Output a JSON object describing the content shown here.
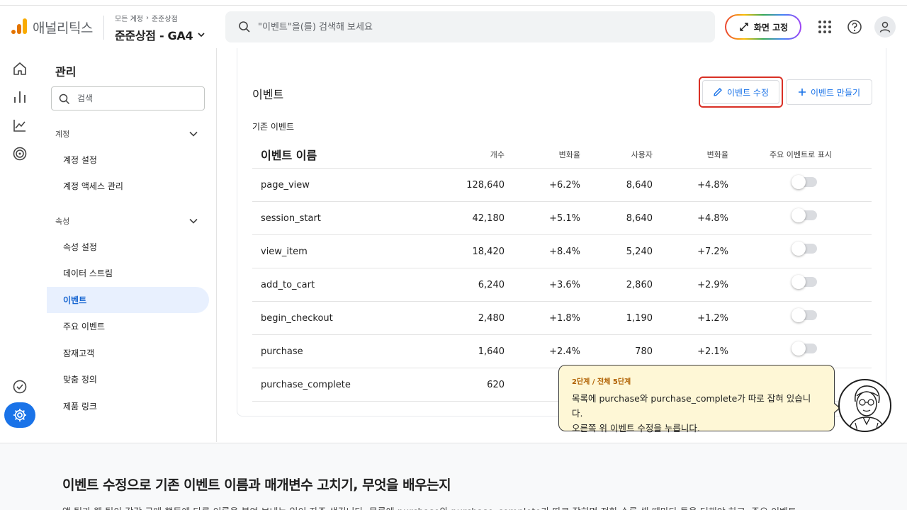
{
  "header": {
    "app_name": "애널리틱스",
    "breadcrumb_all": "모든 계정",
    "breadcrumb_account": "준준상점",
    "property": "준준상점 - GA4",
    "search_placeholder": "\"이벤트\"을(를) 검색해 보세요",
    "pin_label": "화면 고정"
  },
  "admin": {
    "title": "관리",
    "search_placeholder": "검색",
    "account_section": "계정",
    "account_items": [
      "계정 설정",
      "계정 액세스 관리"
    ],
    "property_section": "속성",
    "property_items": [
      "속성 설정",
      "데이터 스트림",
      "이벤트",
      "주요 이벤트",
      "잠재고객",
      "맞춤 정의",
      "제품 링크"
    ],
    "active_item": "이벤트"
  },
  "events": {
    "title": "이벤트",
    "edit_button": "이벤트 수정",
    "create_button": "이벤트 만들기",
    "subtitle": "기존 이벤트",
    "columns": [
      "이벤트 이름",
      "개수",
      "변화율",
      "사용자",
      "변화율",
      "주요 이벤트로 표시"
    ],
    "rows": [
      {
        "name": "page_view",
        "count": "128,640",
        "count_change": "+6.2%",
        "users": "8,640",
        "users_change": "+4.8%",
        "key": false
      },
      {
        "name": "session_start",
        "count": "42,180",
        "count_change": "+5.1%",
        "users": "8,640",
        "users_change": "+4.8%",
        "key": false
      },
      {
        "name": "view_item",
        "count": "18,420",
        "count_change": "+8.4%",
        "users": "5,240",
        "users_change": "+7.2%",
        "key": false
      },
      {
        "name": "add_to_cart",
        "count": "6,240",
        "count_change": "+3.6%",
        "users": "2,860",
        "users_change": "+2.9%",
        "key": false
      },
      {
        "name": "begin_checkout",
        "count": "2,480",
        "count_change": "+1.8%",
        "users": "1,190",
        "users_change": "+1.2%",
        "key": false
      },
      {
        "name": "purchase",
        "count": "1,640",
        "count_change": "+2.4%",
        "users": "780",
        "users_change": "+2.1%",
        "key": false
      },
      {
        "name": "purchase_complete",
        "count": "620",
        "count_change": "+",
        "users": "",
        "users_change": "",
        "key": false
      }
    ]
  },
  "tooltip": {
    "step": "2단계 / 전체 5단계",
    "line1": "목록에 purchase와 purchase_complete가 따로 잡혀 있습니다.",
    "line2": "오른쪽 위 이벤트 수정을 누릅니다."
  },
  "lesson": {
    "title": "이벤트 수정으로 기존 이벤트 이름과 매개변수 고치기, 무엇을 배우는지",
    "body": "앱 팀과 웹 팀이 각각 구매 행동에 다른 이름을 붙여 보내는 일이 자주 생깁니다. 목록에 purchase와 purchase_complete가 따로 잡히면 전환 수를 셀 때마다 둘을 더해야 하고, 주요 이벤트"
  },
  "colors": {
    "brand_orange": "#e37400",
    "brand_yellow": "#f9ab00",
    "primary_blue": "#1a73e8",
    "highlight_red": "#d93025",
    "tooltip_bg": "#fef7d6"
  }
}
